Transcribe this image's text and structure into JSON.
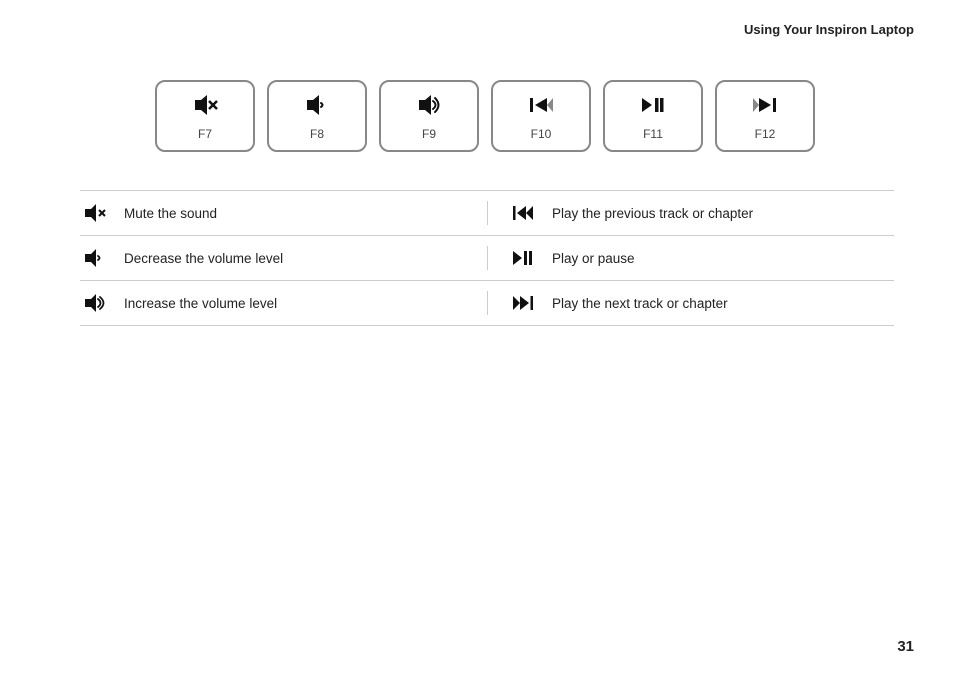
{
  "header": {
    "title": "Using Your Inspiron Laptop"
  },
  "keys": [
    {
      "id": "f7",
      "label": "F7",
      "icon": "mute"
    },
    {
      "id": "f8",
      "label": "F8",
      "icon": "vol-down"
    },
    {
      "id": "f9",
      "label": "F9",
      "icon": "vol-up"
    },
    {
      "id": "f10",
      "label": "F10",
      "icon": "prev"
    },
    {
      "id": "f11",
      "label": "F11",
      "icon": "play-pause"
    },
    {
      "id": "f12",
      "label": "F12",
      "icon": "next"
    }
  ],
  "rows": [
    {
      "left_icon": "mute",
      "left_desc": "Mute the sound",
      "right_icon": "prev",
      "right_desc": "Play the previous track or chapter"
    },
    {
      "left_icon": "vol-down",
      "left_desc": "Decrease the volume level",
      "right_icon": "play-pause",
      "right_desc": "Play or pause"
    },
    {
      "left_icon": "vol-up",
      "left_desc": "Increase the volume level",
      "right_icon": "next",
      "right_desc": "Play the next track or chapter"
    }
  ],
  "page_number": "31"
}
